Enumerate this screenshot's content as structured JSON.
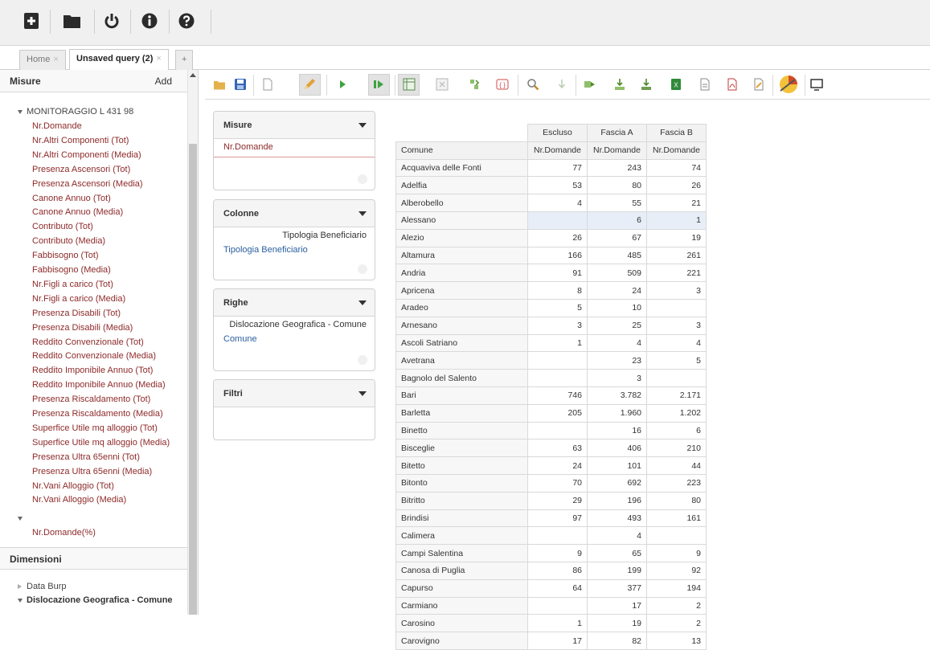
{
  "toolbar": {
    "icons": [
      "new-query-icon",
      "open-folder-icon",
      "power-icon",
      "info-icon",
      "help-icon"
    ]
  },
  "tabs": [
    {
      "label": "Home",
      "close": "×"
    },
    {
      "label": "Unsaved query (2)",
      "close": "×"
    },
    {
      "label": "+"
    }
  ],
  "sidebar": {
    "measures_title": "Misure",
    "add_label": "Add",
    "cube_name": "MONITORAGGIO L 431 98",
    "measures": [
      "Nr.Domande",
      "Nr.Altri Componenti (Tot)",
      "Nr.Altri Componenti (Media)",
      "Presenza Ascensori (Tot)",
      "Presenza Ascensori (Media)",
      "Canone Annuo (Tot)",
      "Canone Annuo (Media)",
      "Contributo (Tot)",
      "Contributo (Media)",
      "Fabbisogno (Tot)",
      "Fabbisogno (Media)",
      "Nr.Figli a carico (Tot)",
      "Nr.Figli a carico (Media)",
      "Presenza Disabili (Tot)",
      "Presenza Disabili (Media)",
      "Reddito Convenzionale (Tot)",
      "Reddito Convenzionale (Media)",
      "Reddito Imponibile Annuo (Tot)",
      "Reddito Imponibile Annuo (Media)",
      "Presenza Riscaldamento (Tot)",
      "Presenza Riscaldamento (Media)",
      "Superfice Utile mq alloggio (Tot)",
      "Superfice Utile mq alloggio (Media)",
      "Presenza Ultra 65enni (Tot)",
      "Presenza Ultra 65enni (Media)",
      "Nr.Vani Alloggio (Tot)",
      "Nr.Vani Alloggio (Media)"
    ],
    "calculated_measure": "Nr.Domande(%)",
    "dimensions_title": "Dimensioni",
    "dimensions": [
      {
        "label": "Data Burp",
        "expanded": false
      },
      {
        "label": "Dislocazione Geografica - Comune",
        "expanded": true
      }
    ]
  },
  "actionbar": {
    "icons": [
      "open-icon",
      "save-icon",
      "new-page-icon",
      "edit-icon",
      "run-icon",
      "auto-run-icon",
      "pivot-icon",
      "hide-empty-icon",
      "swap-axes-icon",
      "mdx-icon",
      "zoom-icon",
      "drill-down-icon",
      "drill-across-icon",
      "export-icon",
      "export-down-icon",
      "export-excel-icon",
      "export-csv-icon",
      "export-pdf-icon",
      "export-edit-icon",
      "chart-icon",
      "fullscreen-icon"
    ]
  },
  "panels": {
    "misure": {
      "title": "Misure",
      "items": [
        "Nr.Domande"
      ]
    },
    "colonne": {
      "title": "Colonne",
      "level": "Tipologia Beneficiario",
      "items": [
        "Tipologia Beneficiario"
      ]
    },
    "righe": {
      "title": "Righe",
      "level": "Dislocazione Geografica - Comune",
      "items": [
        "Comune"
      ]
    },
    "filtri": {
      "title": "Filtri",
      "items": []
    }
  },
  "table": {
    "column_groups": [
      "Escluso",
      "Fascia A",
      "Fascia B"
    ],
    "row_header": "Comune",
    "measure_header": "Nr.Domande",
    "rows": [
      {
        "name": "Acquaviva delle Fonti",
        "values": [
          "77",
          "243",
          "74"
        ]
      },
      {
        "name": "Adelfia",
        "values": [
          "53",
          "80",
          "26"
        ]
      },
      {
        "name": "Alberobello",
        "values": [
          "4",
          "55",
          "21"
        ]
      },
      {
        "name": "Alessano",
        "values": [
          "",
          "6",
          "1"
        ]
      },
      {
        "name": "Alezio",
        "values": [
          "26",
          "67",
          "19"
        ]
      },
      {
        "name": "Altamura",
        "values": [
          "166",
          "485",
          "261"
        ]
      },
      {
        "name": "Andria",
        "values": [
          "91",
          "509",
          "221"
        ]
      },
      {
        "name": "Apricena",
        "values": [
          "8",
          "24",
          "3"
        ]
      },
      {
        "name": "Aradeo",
        "values": [
          "5",
          "10",
          ""
        ]
      },
      {
        "name": "Arnesano",
        "values": [
          "3",
          "25",
          "3"
        ]
      },
      {
        "name": "Ascoli Satriano",
        "values": [
          "1",
          "4",
          "4"
        ]
      },
      {
        "name": "Avetrana",
        "values": [
          "",
          "23",
          "5"
        ]
      },
      {
        "name": "Bagnolo del Salento",
        "values": [
          "",
          "3",
          ""
        ]
      },
      {
        "name": "Bari",
        "values": [
          "746",
          "3.782",
          "2.171"
        ]
      },
      {
        "name": "Barletta",
        "values": [
          "205",
          "1.960",
          "1.202"
        ]
      },
      {
        "name": "Binetto",
        "values": [
          "",
          "16",
          "6"
        ]
      },
      {
        "name": "Bisceglie",
        "values": [
          "63",
          "406",
          "210"
        ]
      },
      {
        "name": "Bitetto",
        "values": [
          "24",
          "101",
          "44"
        ]
      },
      {
        "name": "Bitonto",
        "values": [
          "70",
          "692",
          "223"
        ]
      },
      {
        "name": "Bitritto",
        "values": [
          "29",
          "196",
          "80"
        ]
      },
      {
        "name": "Brindisi",
        "values": [
          "97",
          "493",
          "161"
        ]
      },
      {
        "name": "Calimera",
        "values": [
          "",
          "4",
          ""
        ]
      },
      {
        "name": "Campi Salentina",
        "values": [
          "9",
          "65",
          "9"
        ]
      },
      {
        "name": "Canosa di Puglia",
        "values": [
          "86",
          "199",
          "92"
        ]
      },
      {
        "name": "Capurso",
        "values": [
          "64",
          "377",
          "194"
        ]
      },
      {
        "name": "Carmiano",
        "values": [
          "",
          "17",
          "2"
        ]
      },
      {
        "name": "Carosino",
        "values": [
          "1",
          "19",
          "2"
        ]
      },
      {
        "name": "Carovigno",
        "values": [
          "17",
          "82",
          "13"
        ]
      }
    ]
  },
  "colors": {
    "measure_text": "#8e2a2a",
    "link_blue": "#2a5f9e",
    "highlight": "#e7eef7"
  }
}
